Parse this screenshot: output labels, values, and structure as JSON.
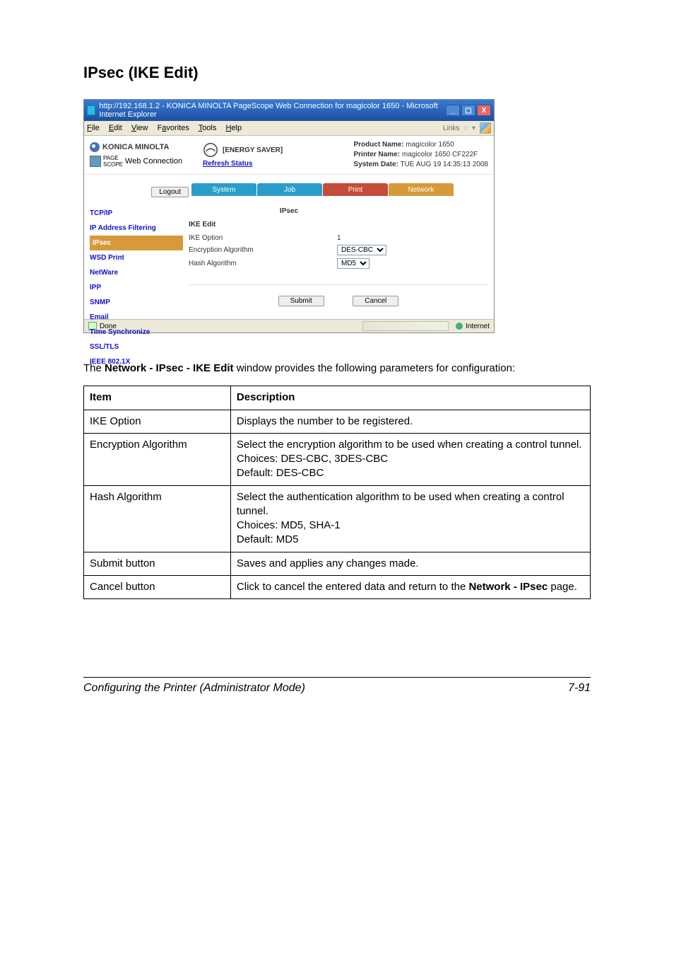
{
  "doc": {
    "heading": "IPsec (IKE Edit)",
    "intro_pre": "The ",
    "intro_bold": "Network - IPsec - IKE Edit",
    "intro_post": " window provides the following parameters for configuration:",
    "footer_left": "Configuring the Printer (Administrator Mode)",
    "footer_right": "7-91"
  },
  "browser": {
    "title": "http://192.168.1.2 - KONICA MINOLTA PageScope Web Connection for magicolor 1650 - Microsoft Internet Explorer",
    "menus": [
      "File",
      "Edit",
      "View",
      "Favorites",
      "Tools",
      "Help"
    ],
    "links_label": "Links",
    "status_done": "Done",
    "status_zone": "Internet"
  },
  "header": {
    "brand": "KONICA MINOLTA",
    "product_line1a": "PAGE",
    "product_line1b": "SCOPE",
    "product_line2": "Web Connection",
    "energy_label": "[ENERGY SAVER]",
    "refresh": "Refresh Status",
    "product_name_label": "Product Name:",
    "product_name_value": "magicolor 1650",
    "printer_name_label": "Printer Name:",
    "printer_name_value": "magicolor 1650 CF222F",
    "system_date_label": "System Date:",
    "system_date_value": "TUE AUG 19 14:35:13 2008"
  },
  "app": {
    "logout": "Logout",
    "tabs": {
      "system": "System",
      "job": "Job",
      "print": "Print",
      "network": "Network"
    },
    "page_label": "IPsec",
    "nav": {
      "tcpip": "TCP/IP",
      "ipfilter": "IP Address Filtering",
      "ipsec": "IPsec",
      "wsd": "WSD Print",
      "netware": "NetWare",
      "ipp": "IPP",
      "snmp": "SNMP",
      "email": "Email",
      "timesync": "Time Synchronize",
      "ssltls": "SSL/TLS",
      "ieee": "IEEE 802.1X"
    },
    "panel_title": "IKE Edit",
    "fields": {
      "ike_option_label": "IKE Option",
      "ike_option_value": "1",
      "enc_alg_label": "Encryption Algorithm",
      "enc_alg_value": "DES-CBC",
      "hash_alg_label": "Hash Algorithm",
      "hash_alg_value": "MD5"
    },
    "submit": "Submit",
    "cancel": "Cancel"
  },
  "table": {
    "head_item": "Item",
    "head_desc": "Description",
    "rows": [
      {
        "item": "IKE Option",
        "desc": "Displays the number to be registered."
      },
      {
        "item": "Encryption Algorithm",
        "desc": "Select the encryption algorithm to be used when creating a control tunnel.\nChoices: DES-CBC, 3DES-CBC\nDefault: DES-CBC"
      },
      {
        "item": "Hash Algorithm",
        "desc": "Select the authentication algorithm to be used when creating a control tunnel.\nChoices: MD5, SHA-1\nDefault: MD5"
      },
      {
        "item": "Submit button",
        "desc": "Saves and applies any changes made."
      },
      {
        "item": "Cancel button",
        "desc_pre": "Click to cancel the entered data and return to the ",
        "desc_bold": "Network - IPsec",
        "desc_post": " page."
      }
    ]
  }
}
